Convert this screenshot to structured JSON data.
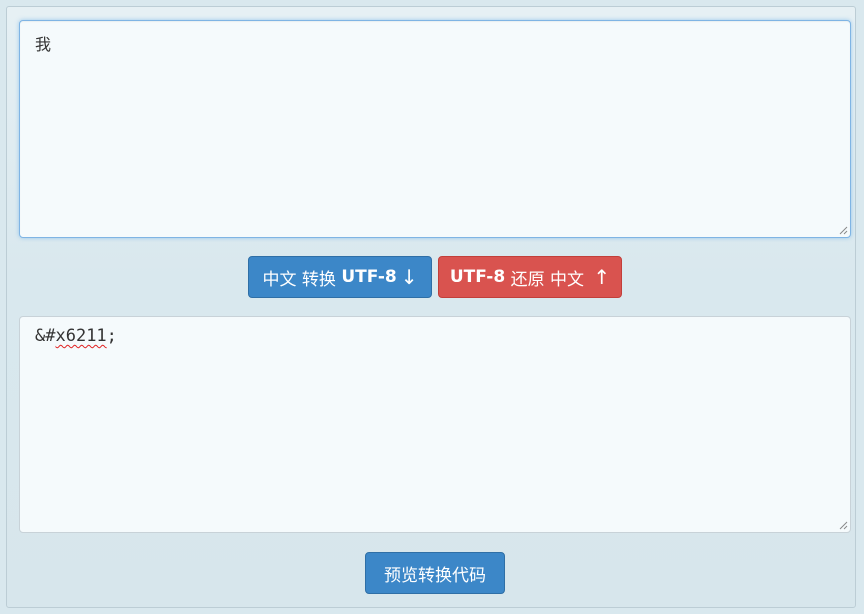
{
  "input": {
    "value": "我"
  },
  "output": {
    "prefix": "&#",
    "code": "x6211",
    "suffix": ";"
  },
  "buttons": {
    "encode": {
      "part1": "中文 转换 ",
      "part2": "UTF-8",
      "arrow": "↓"
    },
    "decode": {
      "part1": "UTF-8",
      "part2": " 还原 中文 ",
      "arrow": "↑"
    },
    "preview": "预览转换代码"
  },
  "colors": {
    "primary": "#3c87c8",
    "danger": "#d9534f",
    "background": "#d9e8ee"
  }
}
